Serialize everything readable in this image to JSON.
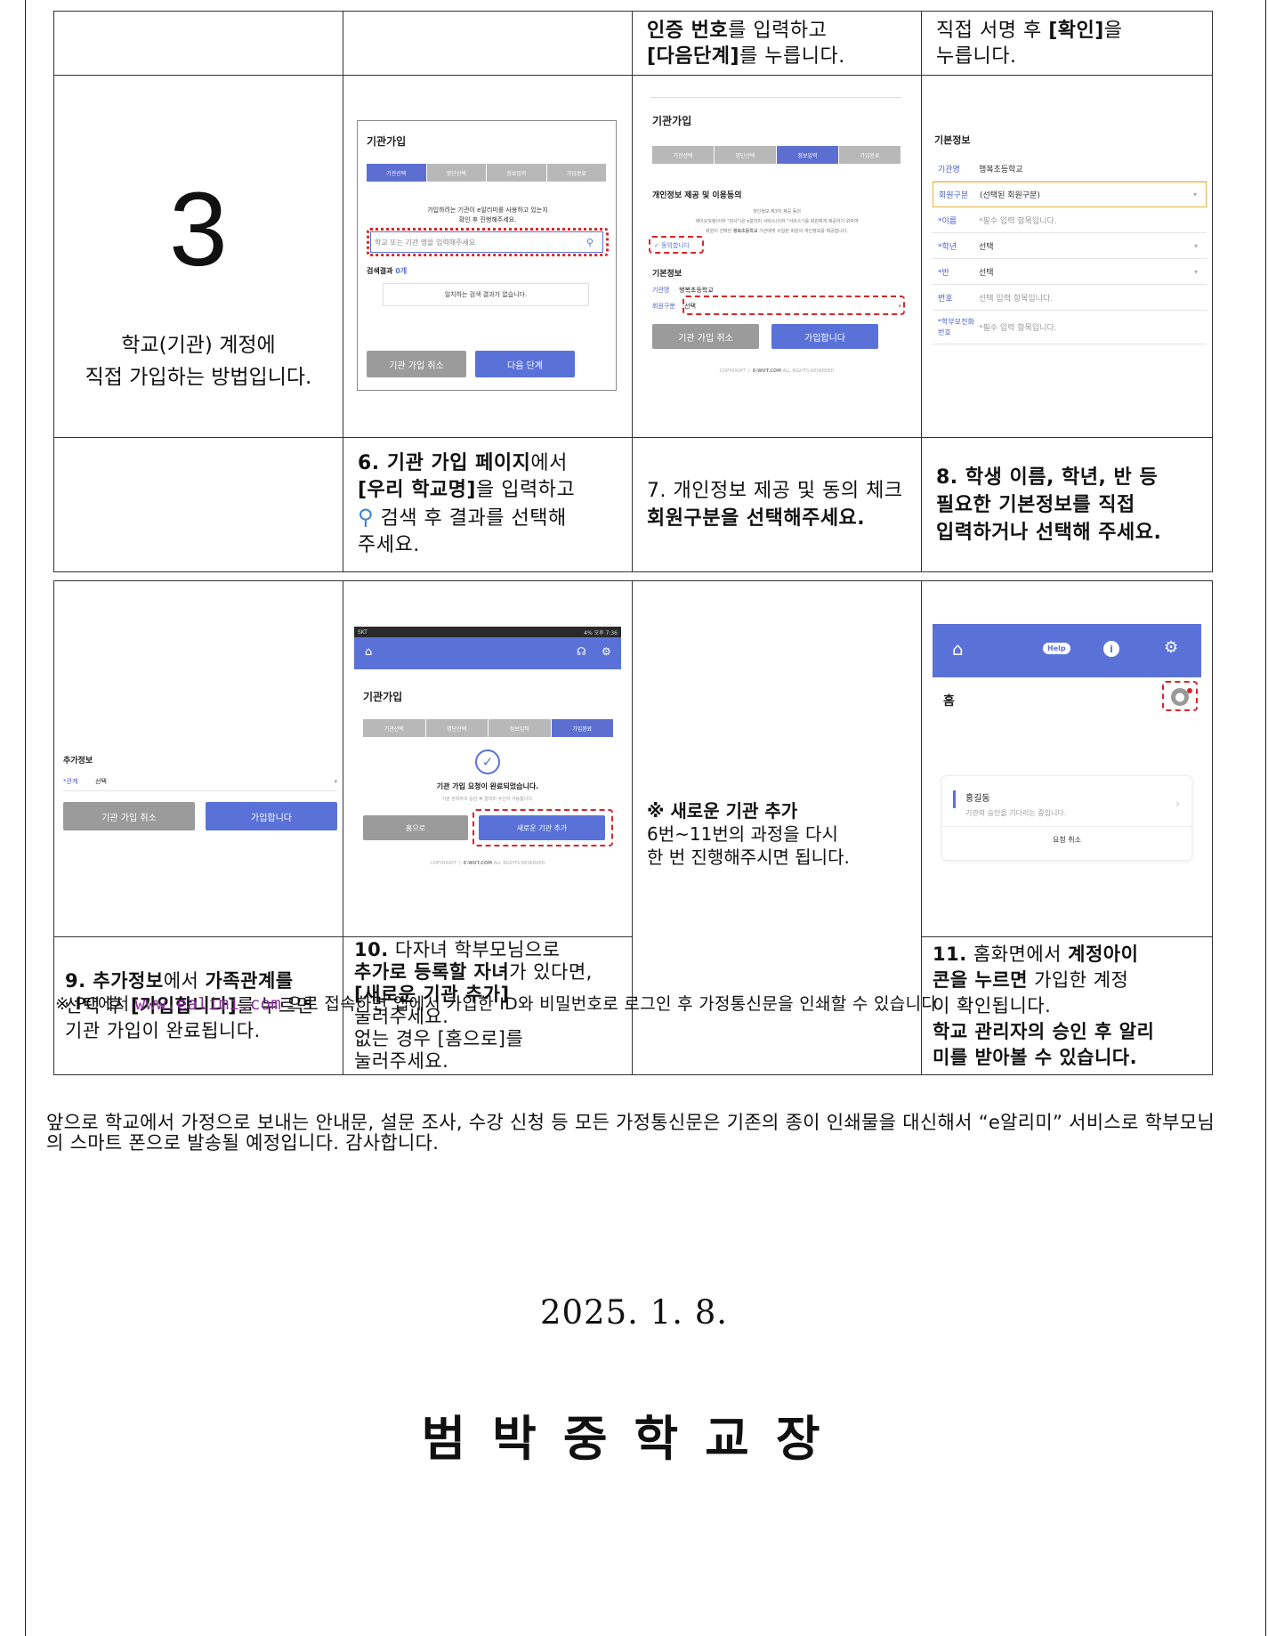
{
  "row0": {
    "c3_a": "인증 번호",
    "c3_b": "를 입력하고",
    "c3_c": "[다음단계]",
    "c3_d": "를 누릅니다.",
    "c4_a": "직접 서명 후 ",
    "c4_b": "[확인]",
    "c4_c": "을",
    "c4_d": "누릅니다."
  },
  "step3": {
    "number": "3",
    "line1": "학교(기관) 계정에",
    "line2": "직접 가입하는 방법입니다."
  },
  "mock6": {
    "title": "기관가입",
    "steps": [
      "기관선택",
      "명단선택",
      "정보입력",
      "가입완료"
    ],
    "notice1": "가입하려는 기관이 e알리미를 사용하고 있는지",
    "notice2": "확인 후 진행해주세요.",
    "search_placeholder": "학교 또는 기관 명을 입력해주세요",
    "result_label": "검색결과",
    "result_count": "0개",
    "empty": "일치하는 검색 결과가 없습니다.",
    "cancel": "기관 가입 취소",
    "next": "다음 단계"
  },
  "mock7": {
    "title": "기관가입",
    "steps": [
      "기관선택",
      "명단선택",
      "정보입력",
      "가입완료"
    ],
    "consent_title": "개인정보 제공 및 이용동의",
    "consent_sub": "개인정보 제3자 제공 동의",
    "consent_line1": "에이웃닷컴(이하 \"회사\")은 e알리미 서비스(이하 \"서비스\")를 회원에게 제공하기 위하여",
    "consent_line2_a": "회원이 선택한 ",
    "consent_line2_b": "행복초등학교",
    "consent_line2_c": " 기관에게 수집된 회원의 개인정보를 제공합니다.",
    "agree": "✓ 동의합니다",
    "basic_title": "기본정보",
    "org_key": "기관명",
    "org_val": "행복초등학교",
    "type_key": "회원구분",
    "type_val": "선택",
    "cancel": "기관 가입 취소",
    "join": "가입합니다",
    "copyright_a": "COPYRIGHT ⓒ ",
    "copyright_b": "E-WUT.COM",
    "copyright_c": " ALL RIGHTS RESERVED"
  },
  "mock8": {
    "title": "기본정보",
    "fields": [
      {
        "k": "기관명",
        "v": "행복초등학교",
        "arr": ""
      },
      {
        "k": "회원구분",
        "v": "(선택된 회원구분)",
        "arr": "▾"
      },
      {
        "k": "*이름",
        "v": "*필수 입력 항목입니다.",
        "arr": ""
      },
      {
        "k": "*학년",
        "v": "선택",
        "arr": "▾"
      },
      {
        "k": "*반",
        "v": "선택",
        "arr": "▾"
      },
      {
        "k": "번호",
        "v": "선택 입력 항목입니다.",
        "arr": ""
      },
      {
        "k": "*학부모전화번호",
        "v": "*필수 입력 항목입니다.",
        "arr": ""
      }
    ]
  },
  "row1": {
    "c2_a": "6. 기관 가입 페이지",
    "c2_b": "에서",
    "c2_c": "[우리 학교명]",
    "c2_d": "을 입력하고",
    "c2_e": "검색 후 결과를 선택해",
    "c2_f": "주세요.",
    "c3_a": "7. 개인정보 제공 및 동의 체크",
    "c3_b": "회원구분을 선택해주세요.",
    "c4_a": "8. 학생 이름, 학년, 반 등",
    "c4_b": "필요한 기본정보를 직접",
    "c4_c": "입력하거나 선택해 주세요."
  },
  "mock9": {
    "title": "추가정보",
    "rel_key": "*관계",
    "rel_val": "선택",
    "cancel": "기관 가입 취소",
    "join": "가입합니다"
  },
  "mock10": {
    "status_left": "SKT",
    "status_right": "4% 오후 7:36",
    "title": "기관가입",
    "steps": [
      "기관선택",
      "명단선택",
      "정보입력",
      "가입완료"
    ],
    "done": "기관 가입 요청이 완료되었습니다.",
    "done_sub": "기관 관리자의 승인 후 알리미 수신이 가능합니다.",
    "home": "홈으로",
    "new_org": "새로운 기관 추가",
    "copyright_a": "COPYRIGHT ⓒ ",
    "copyright_b": "E-WUT.COM",
    "copyright_c": " ALL RIGHTS RESERVED"
  },
  "cell_new": {
    "title": "※ 새로운 기관 추가",
    "line1": "6번~11번의 과정을 다시",
    "line2": "한 번 진행해주시면 됩니다."
  },
  "mock11": {
    "help": "Help",
    "home_title": "홈",
    "name": "홍길동",
    "status": "기관의 승인을 기다리는 중입니다.",
    "cancel": "요청 취소"
  },
  "row3": {
    "c1_a": "9. ",
    "c1_b": "추가정보",
    "c1_c": "에서 ",
    "c1_d": "가족관계",
    "c1_e": "를",
    "c1_f": "선택 후 ",
    "c1_g": "[가입합니다]",
    "c1_h": "를 누르면",
    "c1_i": "기관 가입이 완료됩니다.",
    "c2_a": "10.",
    "c2_b": " 다자녀 학부모님으로",
    "c2_c": "추가로 등록할 자녀",
    "c2_d": "가 있다면,",
    "c2_e": "[새로운 기관 추가]",
    "c2_f": "눌러주세요.",
    "c2_g": "없는 경우 [홈으로]를",
    "c2_h": "눌러주세요.",
    "c4_a": "11.",
    "c4_b": " 홈화면에서 ",
    "c4_c": "계정아이",
    "c4_d": "콘을 누르면",
    "c4_e": " 가입한 계정",
    "c4_f": "이 확인됩니다.",
    "c4_g": "학교 관리자의 승인 후 알리",
    "c4_h": "미를 받아볼 수 있습니다."
  },
  "footnote": {
    "a": "※ PC에서 ",
    "link": "www.ealimi.com",
    "b": " 으로 접속하면 앱에서 가입한 ID와 비밀번호로 로그인 후 가정통신문을 인쇄할 수 있습니다."
  },
  "paragraph": "앞으로 학교에서 가정으로 보내는 안내문, 설문 조사, 수강 신청 등 모든 가정통신문은 기존의 종이 인쇄물을 대신해서 “e알리미” 서비스로 학부모님의 스마트 폰으로 발송될 예정입니다. 감사합니다.",
  "date": "2025. 1. 8.",
  "signature": "범박중학교장",
  "colors": {
    "accent": "#5a72d8",
    "highlight": "#d8262c",
    "link": "#8a2b9e"
  }
}
